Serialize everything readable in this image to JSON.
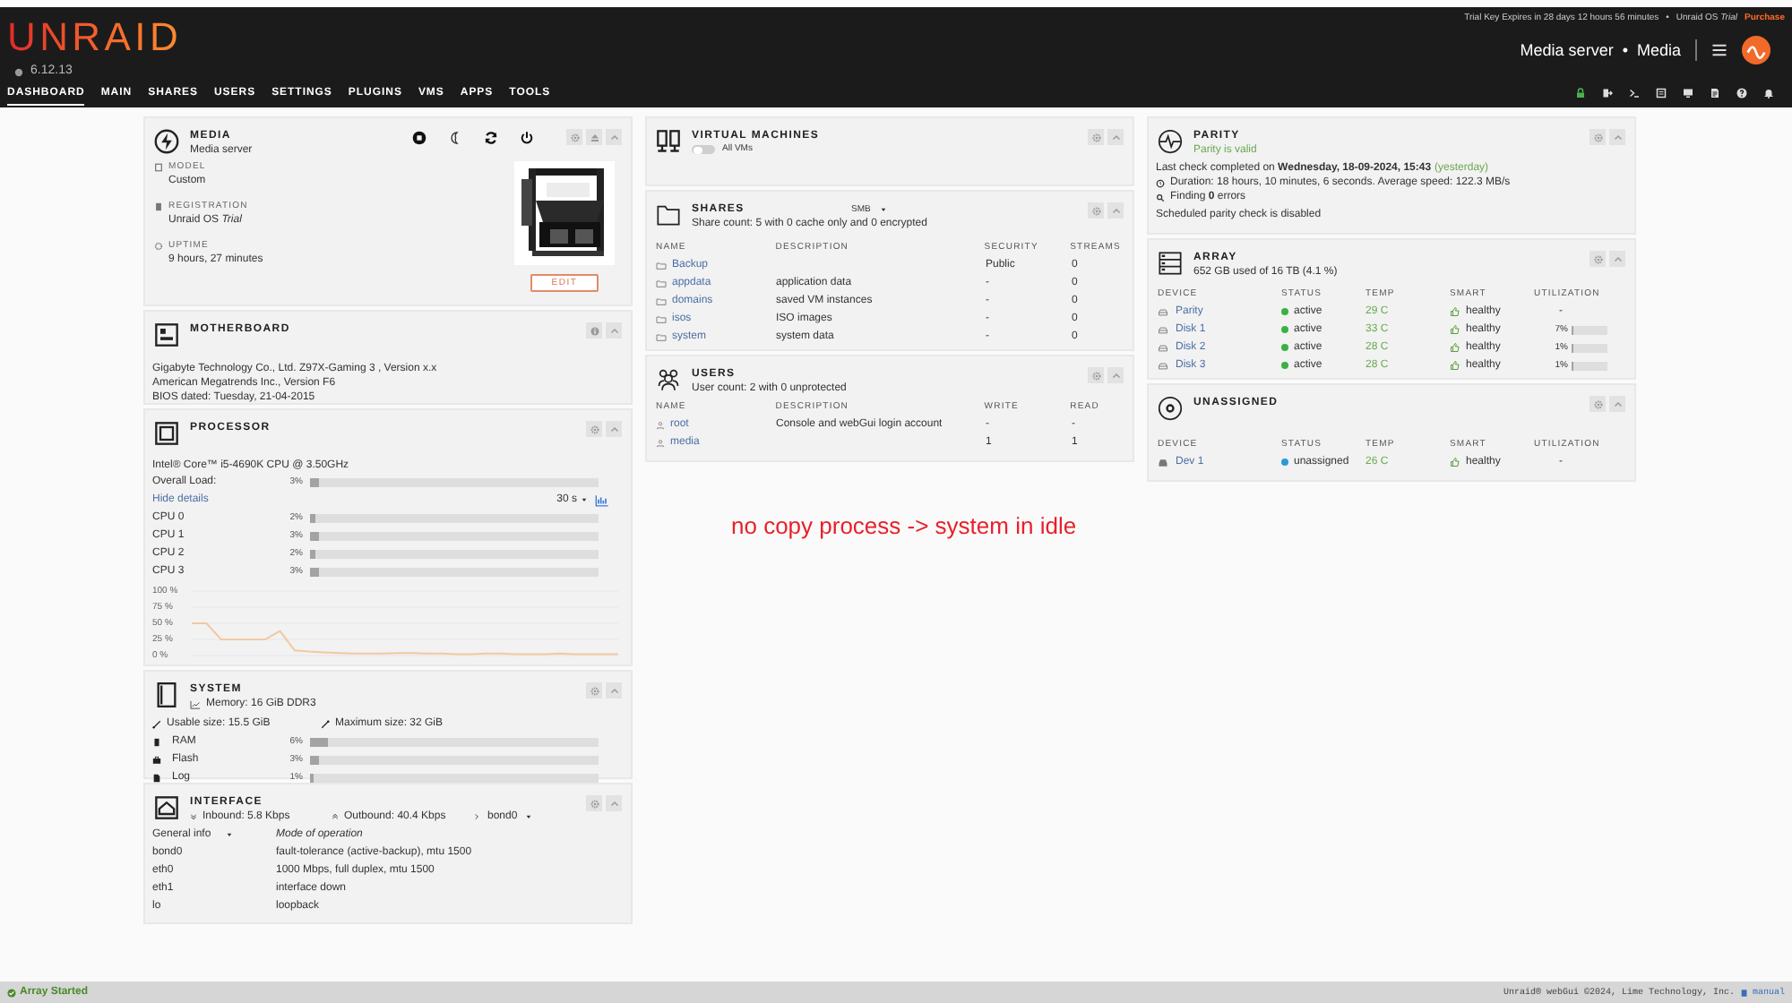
{
  "header": {
    "logo": "UNRAID",
    "version": "6.12.13",
    "trial_notice": "Trial Key Expires in 28 days 12 hours 56 minutes",
    "separator": "•",
    "os_label": "Unraid OS *Trial*",
    "purchase": "Purchase",
    "server_name": "Media server",
    "server_separator": "•",
    "server_description": "Media",
    "nav": [
      {
        "label": "DASHBOARD",
        "selected": true
      },
      {
        "label": "MAIN",
        "selected": false
      },
      {
        "label": "SHARES",
        "selected": false
      },
      {
        "label": "USERS",
        "selected": false
      },
      {
        "label": "SETTINGS",
        "selected": false
      },
      {
        "label": "PLUGINS",
        "selected": false
      },
      {
        "label": "VMS",
        "selected": false
      },
      {
        "label": "APPS",
        "selected": false
      },
      {
        "label": "TOOLS",
        "selected": false
      }
    ]
  },
  "media": {
    "title": "MEDIA",
    "subtitle": "Media server",
    "fields": [
      {
        "label": "MODEL",
        "value": "Custom"
      },
      {
        "label": "REGISTRATION",
        "value": "Unraid OS *Trial*"
      },
      {
        "label": "UPTIME",
        "value": "9 hours, 27 minutes"
      }
    ],
    "edit_button": "EDIT"
  },
  "motherboard": {
    "title": "MOTHERBOARD",
    "lines": [
      "Gigabyte Technology Co., Ltd. Z97X-Gaming 3 , Version x.x",
      "American Megatrends Inc., Version F6",
      "BIOS dated: Tuesday, 21-04-2015"
    ]
  },
  "processor": {
    "title": "PROCESSOR",
    "cpu_name": "Intel® Core™ i5-4690K CPU @ 3.50GHz",
    "overall": {
      "label": "Overall Load:",
      "reading": "3%",
      "level": 0.03
    },
    "details_link": "Hide details",
    "interval": "30 s",
    "cores": [
      {
        "label": "CPU 0",
        "reading": "2%",
        "level": 0.02
      },
      {
        "label": "CPU 1",
        "reading": "3%",
        "level": 0.03
      },
      {
        "label": "CPU 2",
        "reading": "2%",
        "level": 0.02
      },
      {
        "label": "CPU 3",
        "reading": "3%",
        "level": 0.03
      }
    ],
    "chart_data": {
      "type": "line",
      "grid": true,
      "ylim": [
        0,
        100
      ],
      "yticks": [
        {
          "value": 100,
          "label": "100 %"
        },
        {
          "value": 75,
          "label": "75 %"
        },
        {
          "value": 50,
          "label": "50 %"
        },
        {
          "value": 25,
          "label": "25 %"
        },
        {
          "value": 0,
          "label": "0 %"
        }
      ],
      "series": [
        {
          "color": "#f2c9a0",
          "values": [
            50,
            50,
            25,
            25,
            25,
            25,
            38,
            8,
            6,
            5,
            4,
            3,
            3,
            3,
            4,
            4,
            3,
            3,
            2,
            2,
            3,
            3,
            2,
            2,
            2,
            3,
            2,
            2,
            2,
            2
          ]
        }
      ]
    }
  },
  "system": {
    "title": "SYSTEM",
    "memory": "Memory: 16 GiB DDR3",
    "usable": "Usable size: 15.5 GiB",
    "maximum": "Maximum size: 32 GiB",
    "meters": [
      {
        "label": "RAM",
        "reading": "6%",
        "level": 0.06
      },
      {
        "label": "Flash",
        "reading": "3%",
        "level": 0.03
      },
      {
        "label": "Log",
        "reading": "1%",
        "level": 0.01
      }
    ]
  },
  "interface": {
    "title": "INTERFACE",
    "inbound": "Inbound: 5.8 Kbps",
    "outbound": "Outbound: 40.4 Kbps",
    "port": "bond0",
    "view": "General info",
    "column": "Mode of operation",
    "rows": [
      {
        "name": "bond0",
        "info": "fault-tolerance (active-backup), mtu 1500"
      },
      {
        "name": "eth0",
        "info": "1000 Mbps, full duplex, mtu 1500"
      },
      {
        "name": "eth1",
        "info": "interface down"
      },
      {
        "name": "lo",
        "info": "loopback"
      }
    ]
  },
  "vms": {
    "title": "VIRTUAL MACHINES",
    "toggle_label": "All VMs",
    "on": false
  },
  "shares": {
    "title": "SHARES",
    "protocol": "SMB",
    "subtitle": "Share count: 5 with 0 cache only and 0 encrypted",
    "columns": [
      "NAME",
      "DESCRIPTION",
      "SECURITY",
      "STREAMS"
    ],
    "rows": [
      {
        "name": "Backup",
        "description": "",
        "security": "Public",
        "streams": "0"
      },
      {
        "name": "appdata",
        "description": "application data",
        "security": "-",
        "streams": "0"
      },
      {
        "name": "domains",
        "description": "saved VM instances",
        "security": "-",
        "streams": "0"
      },
      {
        "name": "isos",
        "description": "ISO images",
        "security": "-",
        "streams": "0"
      },
      {
        "name": "system",
        "description": "system data",
        "security": "-",
        "streams": "0"
      }
    ]
  },
  "users": {
    "title": "USERS",
    "subtitle": "User count: 2 with 0 unprotected",
    "columns": [
      "NAME",
      "DESCRIPTION",
      "WRITE",
      "READ"
    ],
    "rows": [
      {
        "name": "root",
        "description": "Console and webGui login account",
        "write": "-",
        "read": "-"
      },
      {
        "name": "media",
        "description": "",
        "write": "1",
        "read": "1"
      }
    ]
  },
  "parity": {
    "title": "PARITY",
    "status": "Parity is valid",
    "last_check": "Last check completed on **Wednesday, 18-09-2024, 15:43**",
    "relative": "(yesterday)",
    "duration": "Duration: 18 hours, 10 minutes, 6 seconds. Average speed: 122.3 MB/s",
    "finding": "Finding **0** errors",
    "schedule": "Scheduled parity check is disabled"
  },
  "array": {
    "title": "ARRAY",
    "subtitle": "652 GB used of 16 TB (4.1 %)",
    "columns": [
      "DEVICE",
      "STATUS",
      "TEMP",
      "SMART",
      "UTILIZATION"
    ],
    "rows": [
      {
        "device": "Parity",
        "status": "active",
        "color": "#3bb143",
        "temp": "29 C",
        "smart": "healthy",
        "utilization": "-"
      },
      {
        "device": "Disk 1",
        "status": "active",
        "color": "#3bb143",
        "temp": "33 C",
        "smart": "healthy",
        "utilization": "7%",
        "level": 0.07
      },
      {
        "device": "Disk 2",
        "status": "active",
        "color": "#3bb143",
        "temp": "28 C",
        "smart": "healthy",
        "utilization": "1%",
        "level": 0.01
      },
      {
        "device": "Disk 3",
        "status": "active",
        "color": "#3bb143",
        "temp": "28 C",
        "smart": "healthy",
        "utilization": "1%",
        "level": 0.01
      }
    ]
  },
  "unassigned": {
    "title": "UNASSIGNED",
    "columns": [
      "DEVICE",
      "STATUS",
      "TEMP",
      "SMART",
      "UTILIZATION"
    ],
    "rows": [
      {
        "device": "Dev 1",
        "status": "unassigned",
        "color": "#2b9ad8",
        "temp": "26 C",
        "smart": "healthy",
        "utilization": "-"
      }
    ]
  },
  "annotation": "no copy process -> system in idle",
  "footer": {
    "status": "Array Started",
    "copyright": "Unraid® webGui ©2024, Lime Technology, Inc.",
    "manual": "manual"
  }
}
